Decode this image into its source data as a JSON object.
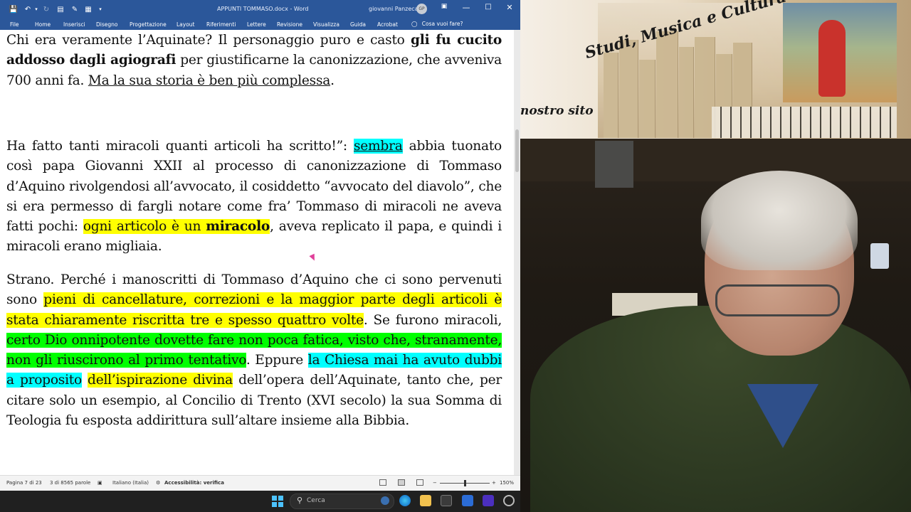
{
  "titlebar": {
    "document_title": "APPUNTI TOMMASO.docx - Word",
    "user_name": "giovanni Panzeca",
    "user_initials": "GP"
  },
  "ribbon": {
    "tabs": [
      "File",
      "Home",
      "Inserisci",
      "Disegno",
      "Progettazione",
      "Layout",
      "Riferimenti",
      "Lettere",
      "Revisione",
      "Visualizza",
      "Guida",
      "Acrobat"
    ],
    "tell_me": "Cosa vuoi fare?"
  },
  "document": {
    "p1": {
      "s1": "Chi era veramente l’Aquinate? Il personaggio puro e casto ",
      "s2": "gli fu cucito addosso dagli agiografi",
      "s3": " per giustificarne la canonizzazione, che avveniva 700 anni fa. ",
      "s4": "Ma la sua storia è ben più complessa",
      "s5": "."
    },
    "p2": {
      "s1": "Ha fatto tanti miracoli quanti articoli ha scritto!”: ",
      "s2": "sembra",
      "s3": " abbia tuonato così papa Giovanni XXII al processo di canonizzazione di Tommaso d’Aquino rivolgendosi all’avvocato, il cosiddetto “avvocato del diavolo”, che si era permesso di fargli notare come fra’ Tommaso di miracoli ne aveva fatti pochi: ",
      "s4": "ogni articolo è un ",
      "s5": "miracolo",
      "s6": ", aveva replicato il papa, e quindi i miracoli erano migliaia."
    },
    "p3": {
      "s1": " Strano. Perché i manoscritti di Tommaso d’Aquino che ci sono pervenuti sono ",
      "s2": "pieni di cancellature, correzioni e la maggior parte degli articoli è stata chiaramente riscritta tre e spesso quattro volte",
      "s3": ". Se furono miracoli, ",
      "s4": "certo Dio onnipotente dovette fare non poca fatica, visto che, stranamente, non gli riuscirono al primo tentativo",
      "s5": ". Eppure ",
      "s6": "la Chiesa mai ha avuto dubbi a proposito",
      "s7": " ",
      "s8": "dell’ispirazione divina",
      "s9": " dell’opera dell’Aquinate, tanto che, per citare solo un esempio, al Concilio di Trento (XVI secolo) la sua Somma di Teologia fu esposta addirittura sull’altare insieme alla Bibbia."
    }
  },
  "statusbar": {
    "page": "Pagina 7 di 23",
    "words": "3 di 8565 parole",
    "language": "Italiano (Italia)",
    "accessibility": "Accessibilità: verifica",
    "zoom": "150%"
  },
  "taskbar": {
    "search_placeholder": "Cerca"
  },
  "banner": {
    "title": "Studi, Musica e Cultura",
    "subtitle": "nostro sito"
  },
  "colors": {
    "word_blue": "#2b579a",
    "highlight_yellow": "#ffff00",
    "highlight_cyan": "#00ffff",
    "highlight_green": "#00ff00"
  }
}
